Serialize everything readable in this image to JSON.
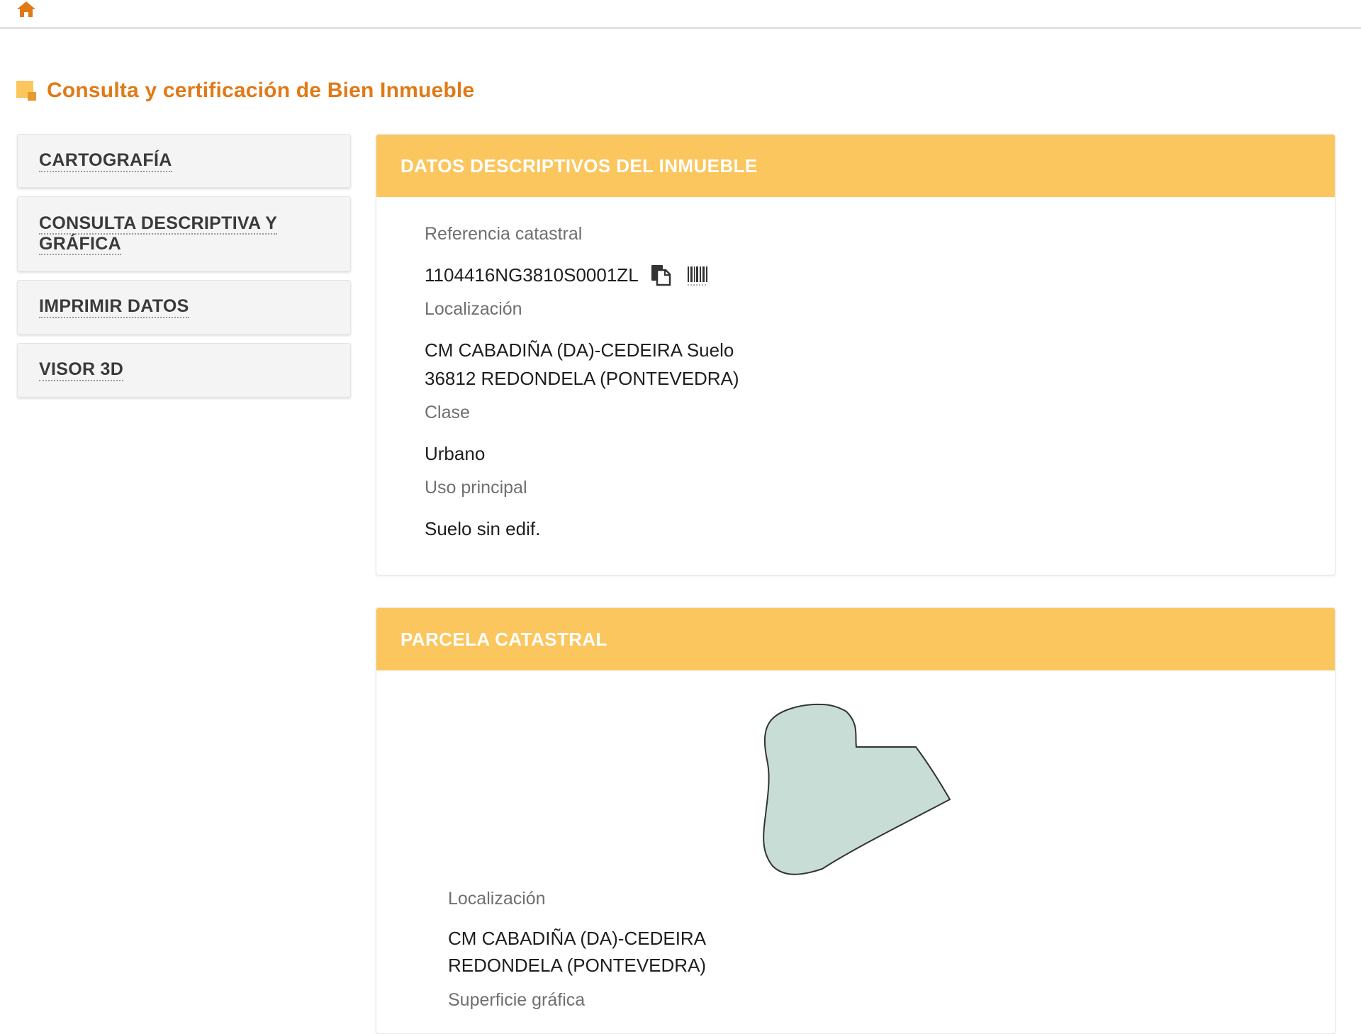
{
  "topbar": {
    "home_icon": "home-icon"
  },
  "header": {
    "title": "Consulta y certificación de Bien Inmueble",
    "title_icon": "document-icon"
  },
  "menu": {
    "items": [
      {
        "label": "CARTOGRAFÍA"
      },
      {
        "label_line1": "CONSULTA DESCRIPTIVA Y",
        "label_line2": "GRÁFICA"
      },
      {
        "label": "IMPRIMIR DATOS"
      },
      {
        "label": "VISOR 3D"
      }
    ]
  },
  "datos": {
    "heading": "DATOS DESCRIPTIVOS DEL INMUEBLE",
    "ref_label": "Referencia catastral",
    "ref_value": "1104416NG3810S0001ZL",
    "loc_label": "Localización",
    "loc_line1": "CM CABADIÑA (DA)-CEDEIRA Suelo",
    "loc_line2": "36812 REDONDELA (PONTEVEDRA)",
    "clase_label": "Clase",
    "clase_value": "Urbano",
    "uso_label": "Uso principal",
    "uso_value": "Suelo sin edif."
  },
  "parcela": {
    "heading": "PARCELA CATASTRAL",
    "loc_label": "Localización",
    "loc_line1": "CM CABADIÑA (DA)-CEDEIRA",
    "loc_line2": "REDONDELA (PONTEVEDRA)",
    "superficie_label": "Superficie gráfica"
  },
  "colors": {
    "accent": "#e07a17",
    "card_header": "#fbc65d",
    "parcel_fill": "#c7ddd6",
    "parcel_stroke": "#333333"
  },
  "icons": [
    "home-icon",
    "document-icon",
    "copy-icon",
    "barcode-icon"
  ]
}
